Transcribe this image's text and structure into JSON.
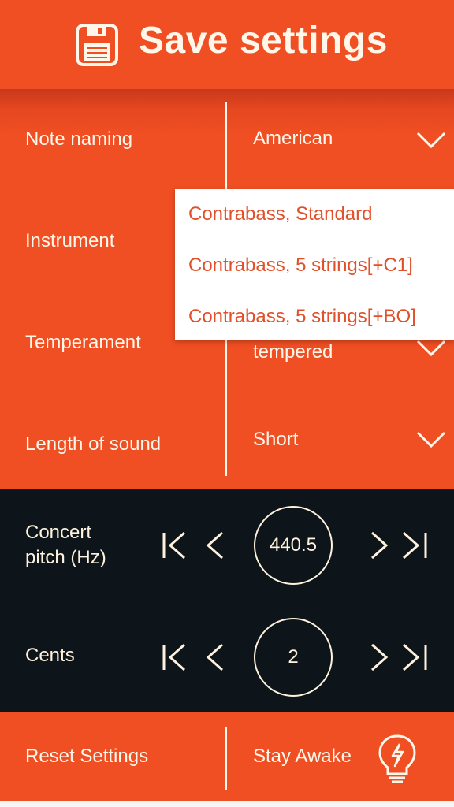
{
  "header": {
    "title": "Save settings",
    "icon": "floppy-disk-icon"
  },
  "settings": {
    "rows": [
      {
        "label": "Note naming",
        "value": "American"
      },
      {
        "label": "Instrument",
        "value": ""
      },
      {
        "label": "Temperament",
        "value": "tempered"
      },
      {
        "label": "Length of sound",
        "value": "Short"
      }
    ]
  },
  "dropdown": {
    "options": [
      "Contrabass, Standard",
      "Contrabass, 5 strings[+C1]",
      "Contrabass, 5 strings[+BO]"
    ]
  },
  "pitch": {
    "concert_label_line1": "Concert",
    "concert_label_line2": "pitch (Hz)",
    "concert_value": "440.5",
    "cents_label": "Cents",
    "cents_value": "2"
  },
  "footer": {
    "reset_label": "Reset Settings",
    "stay_awake_label": "Stay Awake"
  },
  "colors": {
    "accent": "#f04e23",
    "dark": "#0d151b",
    "text_light": "#fff7ea",
    "dropdown_text": "#e0502a"
  }
}
